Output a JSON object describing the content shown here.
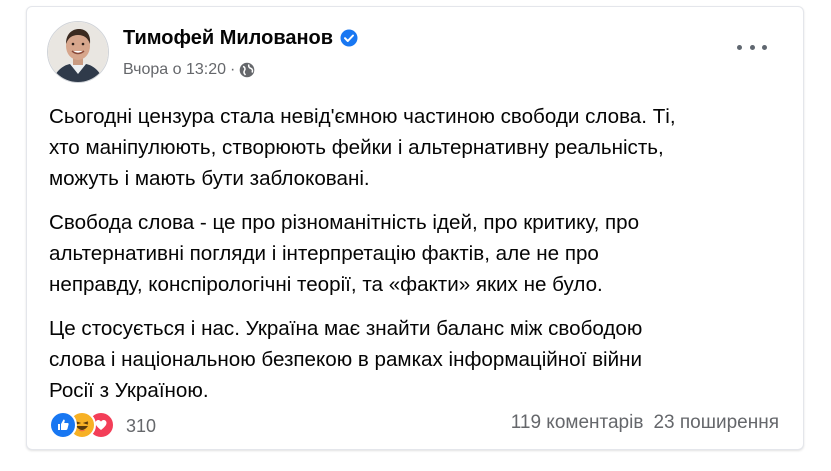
{
  "post": {
    "author": "Тимофей Милованов",
    "timestamp": "Вчора о 13:20",
    "separator": "·",
    "visibility_icon": "globe-icon",
    "verified_icon": "verified-badge-icon",
    "paragraphs": [
      {
        "lines": [
          "Сьогодні цензура стала невід'ємною частиною свободи слова. Ті,",
          "хто маніпулюють, створюють фейки і альтернативну реальність,",
          "можуть і мають бути заблоковані."
        ]
      },
      {
        "lines": [
          "Свобода слова - це про різноманітність ідей, про критику, про",
          "альтернативні погляди і інтерпретацію фактів, але не про",
          "неправду, конспірологічні теорії, та «факти» яких не було."
        ]
      },
      {
        "lines": [
          "Це стосується і нас. Україна має знайти баланс між свободою",
          "слова і національною безпекою в рамках інформаційної війни",
          "Росії з Україною."
        ]
      }
    ],
    "reactions": {
      "icons": [
        "like-icon",
        "haha-icon",
        "love-icon"
      ],
      "count": "310"
    },
    "comments": "119 коментарів",
    "shares": "23 поширення"
  },
  "colors": {
    "primary_text": "#050505",
    "secondary_text": "#65676b",
    "verified_blue": "#1877f2",
    "like_blue": "#1877f2",
    "love_red": "#f33e58",
    "haha_yellow": "#f7b125"
  }
}
